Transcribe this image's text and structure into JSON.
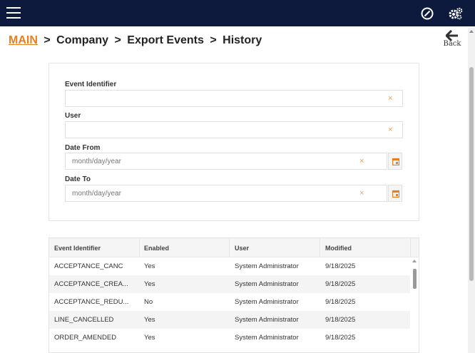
{
  "topbar": {
    "menu_icon": "hamburger-icon",
    "icons": [
      "compass-icon",
      "gears-icon"
    ]
  },
  "breadcrumb": {
    "main": "MAIN",
    "separator": ">",
    "items": [
      "Company",
      "Export Events",
      "History"
    ]
  },
  "back": {
    "label": "Back",
    "icon": "arrow-left-icon"
  },
  "filters": {
    "event_identifier": {
      "label": "Event Identifier",
      "value": ""
    },
    "user": {
      "label": "User",
      "value": ""
    },
    "date_from": {
      "label": "Date From",
      "placeholder": "month/day/year"
    },
    "date_to": {
      "label": "Date To",
      "placeholder": "month/day/year"
    },
    "clear_symbol": "×"
  },
  "table": {
    "columns": [
      "Event Identifier",
      "Enabled",
      "User",
      "Modified"
    ],
    "rows": [
      [
        "ACCEPTANCE_CANC",
        "Yes",
        "System Administrator",
        "9/18/2025"
      ],
      [
        "ACCEPTANCE_CREA...",
        "Yes",
        "System Administrator",
        "9/18/2025"
      ],
      [
        "ACCEPTANCE_REDU...",
        "No",
        "System Administrator",
        "9/18/2025"
      ],
      [
        "LINE_CANCELLED",
        "Yes",
        "System Administrator",
        "9/18/2025"
      ],
      [
        "ORDER_AMENDED",
        "Yes",
        "System Administrator",
        "9/18/2025"
      ]
    ]
  },
  "colors": {
    "topbar": "#0d1a3d",
    "accent": "#e67e22",
    "clear": "#f0a060"
  }
}
